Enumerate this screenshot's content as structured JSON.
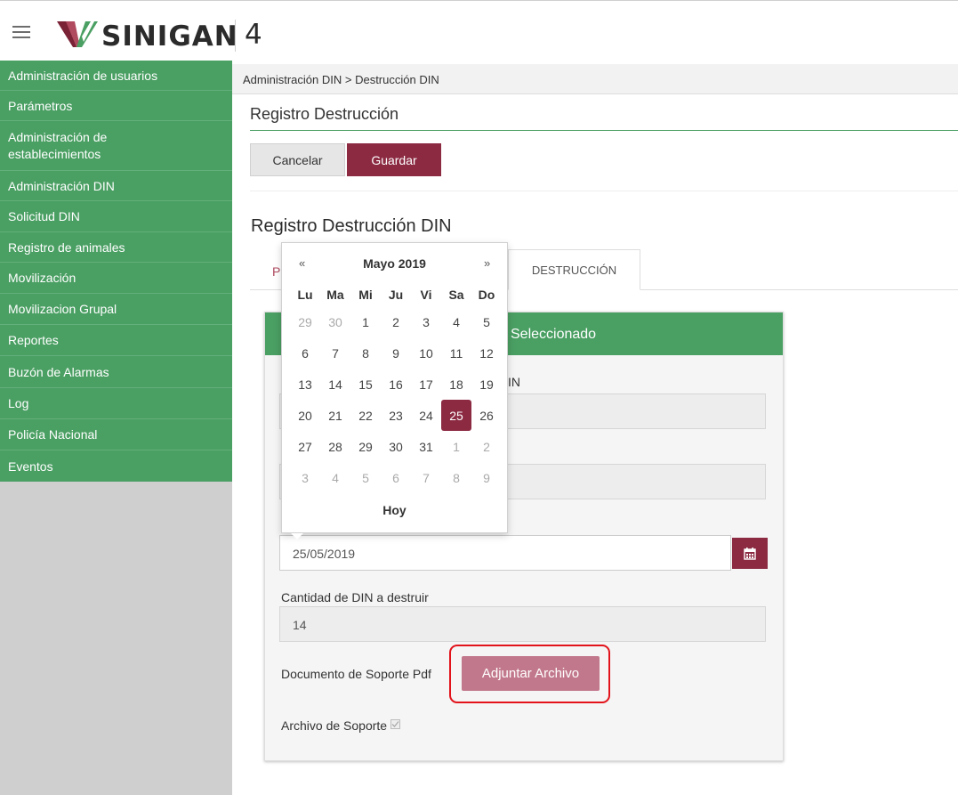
{
  "header": {
    "logo_text": "SINIGAN",
    "version": "4",
    "brand_green": "#4a9f63",
    "brand_red": "#8c2a42"
  },
  "sidebar": {
    "items": [
      {
        "label": "Administración de usuarios"
      },
      {
        "label": "Parámetros"
      },
      {
        "label": "Administración de establecimientos"
      },
      {
        "label": "Administración DIN"
      },
      {
        "label": "Solicitud DIN"
      },
      {
        "label": "Registro de animales"
      },
      {
        "label": "Movilización"
      },
      {
        "label": "Movilizacion Grupal"
      },
      {
        "label": "Reportes"
      },
      {
        "label": "Buzón de Alarmas"
      },
      {
        "label": "Log"
      },
      {
        "label": "Policía Nacional"
      },
      {
        "label": "Eventos"
      }
    ]
  },
  "breadcrumb": "Administración DIN > Destrucción DIN",
  "page": {
    "title": "Registro Destrucción",
    "cancel_label": "Cancelar",
    "save_label": "Guardar",
    "section_title": "Registro Destrucción DIN"
  },
  "tabs": {
    "partial": "P",
    "destruccion": "DESTRUCCIÓN"
  },
  "panel": {
    "header": "Seleccionado",
    "label1_tail": "IN",
    "field1_value": "",
    "field2_value": "",
    "date_value": "25/05/2019",
    "cantidad_label": "Cantidad de DIN a destruir",
    "cantidad_value": "14",
    "documento_label": "Documento de Soporte Pdf",
    "attach_label": "Adjuntar Archivo",
    "archivo_label": "Archivo de Soporte"
  },
  "datepicker": {
    "prev": "«",
    "next": "»",
    "month_title": "Mayo 2019",
    "today_label": "Hoy",
    "weekdays": [
      "Lu",
      "Ma",
      "Mi",
      "Ju",
      "Vi",
      "Sa",
      "Do"
    ],
    "weeks": [
      [
        "29",
        "30",
        "1",
        "2",
        "3",
        "4",
        "5"
      ],
      [
        "6",
        "7",
        "8",
        "9",
        "10",
        "11",
        "12"
      ],
      [
        "13",
        "14",
        "15",
        "16",
        "17",
        "18",
        "19"
      ],
      [
        "20",
        "21",
        "22",
        "23",
        "24",
        "25",
        "26"
      ],
      [
        "27",
        "28",
        "29",
        "30",
        "31",
        "1",
        "2"
      ],
      [
        "3",
        "4",
        "5",
        "6",
        "7",
        "8",
        "9"
      ]
    ],
    "selected": "25"
  }
}
